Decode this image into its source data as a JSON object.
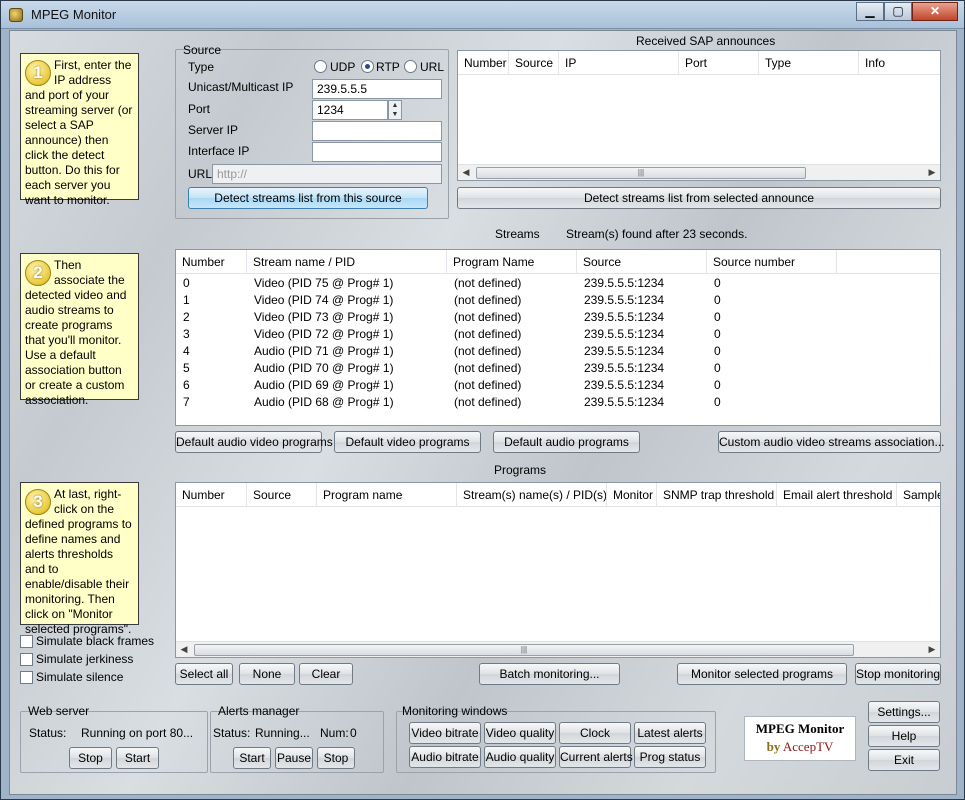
{
  "window": {
    "title": "MPEG Monitor",
    "minimize": "▁",
    "maximize": "▢",
    "close": "✕"
  },
  "help": {
    "step1": {
      "num": "1",
      "text": "First, enter the IP address and port of your streaming server (or select a SAP announce) then click the detect button. Do this for each server you want to monitor."
    },
    "step2": {
      "num": "2",
      "text": "Then associate the detected video and audio streams to create programs that you'll monitor. Use a default association button or create a custom association."
    },
    "step3": {
      "num": "3",
      "text": "At last, right-click on the defined programs to define names and alerts thresholds and to enable/disable their monitoring. Then click on \"Monitor selected programs\"."
    }
  },
  "source": {
    "group_label": "Source",
    "type_label": "Type",
    "udp": "UDP",
    "rtp": "RTP",
    "url": "URL",
    "ip_label": "Unicast/Multicast IP",
    "ip_value": "239.5.5.5",
    "port_label": "Port",
    "port_value": "1234",
    "server_ip_label": "Server IP",
    "server_ip_value": "",
    "interface_ip_label": "Interface IP",
    "interface_ip_value": "",
    "url_label": "URL",
    "url_placeholder": "http://",
    "detect_button": "Detect streams list from this source"
  },
  "sap": {
    "title": "Received SAP announces",
    "columns": [
      "Number",
      "Source",
      "IP",
      "Port",
      "Type",
      "Info"
    ],
    "detect_button": "Detect streams list from selected announce"
  },
  "streams": {
    "title": "Streams",
    "status": "Stream(s) found after 23 seconds.",
    "columns": [
      "Number",
      "Stream name / PID",
      "Program Name",
      "Source",
      "Source number"
    ],
    "rows": [
      [
        "0",
        "Video (PID 75 @ Prog# 1)",
        "(not defined)",
        "239.5.5.5:1234",
        "0"
      ],
      [
        "1",
        "Video (PID 74 @ Prog# 1)",
        "(not defined)",
        "239.5.5.5:1234",
        "0"
      ],
      [
        "2",
        "Video (PID 73 @ Prog# 1)",
        "(not defined)",
        "239.5.5.5:1234",
        "0"
      ],
      [
        "3",
        "Video (PID 72 @ Prog# 1)",
        "(not defined)",
        "239.5.5.5:1234",
        "0"
      ],
      [
        "4",
        "Audio (PID 71 @ Prog# 1)",
        "(not defined)",
        "239.5.5.5:1234",
        "0"
      ],
      [
        "5",
        "Audio (PID 70 @ Prog# 1)",
        "(not defined)",
        "239.5.5.5:1234",
        "0"
      ],
      [
        "6",
        "Audio (PID 69 @ Prog# 1)",
        "(not defined)",
        "239.5.5.5:1234",
        "0"
      ],
      [
        "7",
        "Audio (PID 68 @ Prog# 1)",
        "(not defined)",
        "239.5.5.5:1234",
        "0"
      ]
    ],
    "btn_default_av": "Default audio video programs",
    "btn_default_video": "Default video programs",
    "btn_default_audio": "Default audio programs",
    "btn_custom": "Custom audio video streams association..."
  },
  "programs": {
    "title": "Programs",
    "columns": [
      "Number",
      "Source",
      "Program name",
      "Stream(s) name(s) / PID(s)",
      "Monitor",
      "SNMP trap threshold",
      "Email alert threshold",
      "Sample"
    ],
    "btn_select_all": "Select all",
    "btn_none": "None",
    "btn_clear": "Clear",
    "btn_batch": "Batch monitoring...",
    "btn_monitor_selected": "Monitor selected programs",
    "btn_stop_monitoring": "Stop monitoring"
  },
  "simulate": {
    "black_frames": "Simulate black frames",
    "jerkiness": "Simulate jerkiness",
    "silence": "Simulate silence"
  },
  "web_server": {
    "label": "Web server",
    "status_label": "Status:",
    "status_value": "Running on port 80...",
    "stop": "Stop",
    "start": "Start"
  },
  "alerts": {
    "label": "Alerts manager",
    "status_label": "Status:",
    "status_value": "Running...",
    "num_label": "Num:",
    "num_value": "0",
    "start": "Start",
    "pause": "Pause",
    "stop": "Stop"
  },
  "monitoring_windows": {
    "label": "Monitoring windows",
    "video_bitrate": "Video bitrate",
    "video_quality": "Video quality",
    "clock": "Clock",
    "latest_alerts": "Latest alerts",
    "audio_bitrate": "Audio bitrate",
    "audio_quality": "Audio quality",
    "current_alerts": "Current alerts",
    "prog_status": "Prog status"
  },
  "logo": {
    "line1": "MPEG Monitor",
    "by": "by",
    "brand": "AccepTV"
  },
  "side_buttons": {
    "settings": "Settings...",
    "help": "Help",
    "exit": "Exit"
  }
}
